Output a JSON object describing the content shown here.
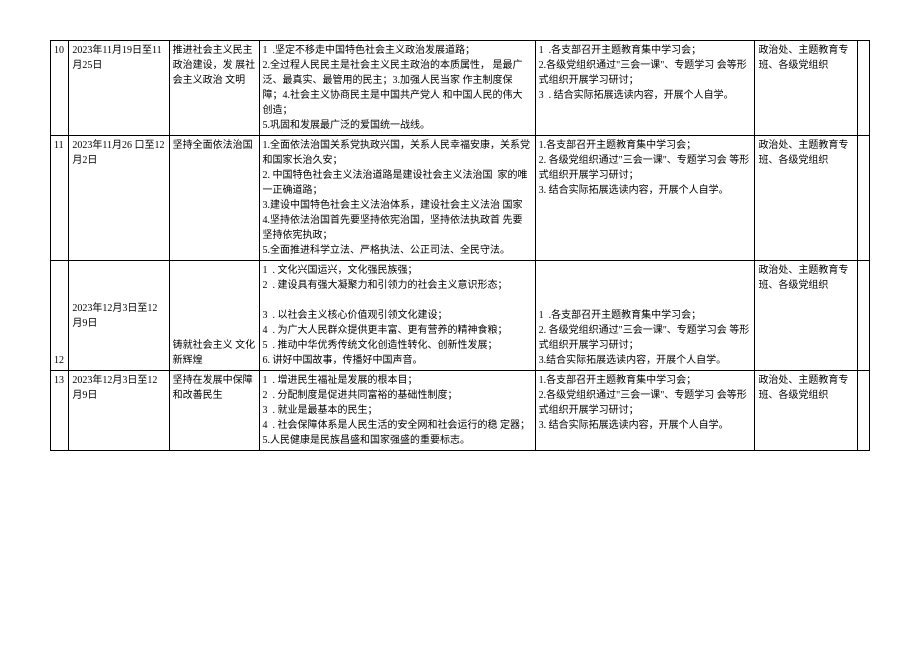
{
  "rows": [
    {
      "idx": "10",
      "date": "2023年11月19日至11月25日",
      "topic": "推进社会主义民主政治建设，发 展社会主义政治 文明",
      "content": "1  .坚定不移走中国特色社会主义政治发展道路；\n2.全过程人民民主是社会主义民主政治的本质属性， 是最广泛、最真实、最管用的民主；3.加强人民当家 作主制度保障；4.社会主义协商民主是中国共产党人 和中国人民的伟大创造；\n5.巩固和发展最广泛的爱国统一战线。",
      "method": "1  .各支部召开主题教育集中学习会；\n2.各级党组织通过\"三会一课\"、专题学习 会等形式组织开展学习研讨；\n3  . 结合实际拓展选读内容，开展个人自学。",
      "org": "政治处、主题教育专班、各级党组织"
    },
    {
      "idx": "11",
      "date": "2023年11月26 口至12月2日",
      "topic": "坚持全面依法治国",
      "content": "1.全面依法治国关系党执政兴国，关系人民幸福安康，关系党和国家长治久安；\n2. 中国特色社会主义法治道路是建设社会主义法治国  家的唯一正确道路；\n3.建设中国特色社会主义法治体系，建设社会主义法治 国家\n4.坚持依法治国首先要坚持依宪治国，坚持依法执政首 先要坚持依宪执政；\n5.全面推进科学立法、严格执法、公正司法、全民守法。",
      "method": "1.各支部召开主题教育集中学习会；\n2. 各级党组织通过\"三会一课\"、专题学习会 等形式组织开展学习研讨；\n3. 结合实际拓展选读内容，开展个人自学。",
      "org": "政治处、主题教育专班、各级党组织"
    },
    {
      "idx": "12",
      "date": "2023年12月3日至12月9日",
      "topic": "铸就社会主义  文化新辉煌",
      "content": "1  . 文化兴国运兴，文化强民族强；\n2  . 建设具有强大凝聚力和引领力的社会主义意识形态；\n\n3  . 以社会主义核心价值观引领文化建设；\n4  . 为广大人民群众提供更丰富、更有营养的精神食粮；\n5  . 推动中华优秀传统文化创造性转化、创新性发展；\n6. 讲好中国故事，传播好中国声音。",
      "method": "1  .各支部召开主题教育集中学习会；\n2. 各级党组织通过\"三会一课\"、专题学习会 等形式组织开展学习研讨；\n3.结合实际拓展选读内容，开展个人自学。",
      "org": "政治处、主题教育专班、各级党组织"
    },
    {
      "idx": "13",
      "date": "2023年12月3日至12月9日",
      "topic": "坚持在发展中保障和改善民生",
      "content": "1  . 增进民生福祉是发展的根本目；\n2  . 分配制度是促进共同富裕的基础性制度；\n3  . 就业是最基本的民生；\n4  . 社会保障体系是人民生活的安全网和社会运行的稳 定器；\n5.人民健康是民族昌盛和国家强盛的重要标志。",
      "method": "1.各支部召开主题教育集中学习会；\n2.各级党组织通过\"三会一课\"、专题学习 会等形式组织开展学习研讨；\n3. 结合实际拓展选读内容，开展个人自学。",
      "org": "政治处、主题教育专班、各级党组织"
    }
  ]
}
